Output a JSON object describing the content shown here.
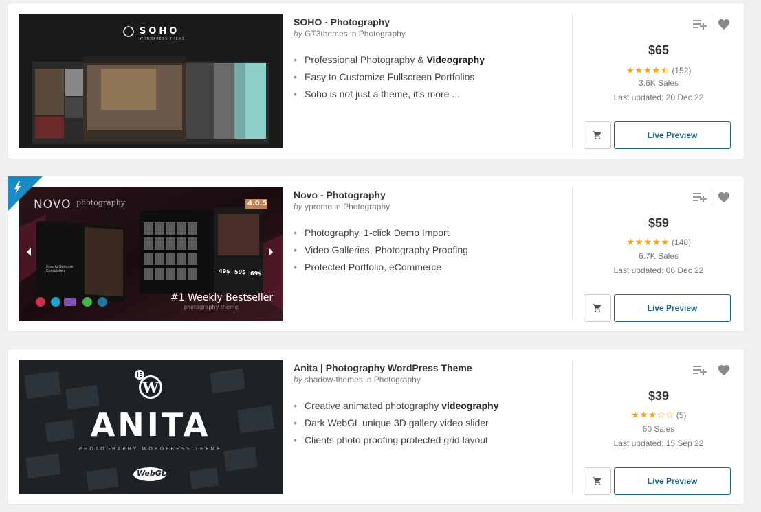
{
  "items": [
    {
      "title": "SOHO - Photography",
      "by": "by",
      "author": "GT3themes",
      "in": "in",
      "category": "Photography",
      "features": [
        {
          "text": "Professional Photography & ",
          "bold": "Videography"
        },
        {
          "text": "Easy to Customize Fullscreen Portfolios",
          "bold": ""
        },
        {
          "text": "Soho is not just a theme, it's more ...",
          "bold": ""
        }
      ],
      "price": "$65",
      "stars": "★★★★⯪",
      "rating_count": 4.5,
      "reviews": "(152)",
      "sales": "3.6K Sales",
      "updated": "Last updated: 20 Dec 22",
      "preview": "Live Preview",
      "thumb": {
        "brand": "SOHO",
        "sub": "WORDPRESS THEME"
      }
    },
    {
      "title": "Novo - Photography",
      "by": "by",
      "author": "ypromo",
      "in": "in",
      "category": "Photography",
      "features": [
        {
          "text": "Photography, 1-click Demo Import",
          "bold": ""
        },
        {
          "text": "Video Galleries, Photography Proofing",
          "bold": ""
        },
        {
          "text": "Protected Portfolio, eCommerce",
          "bold": ""
        }
      ],
      "price": "$59",
      "stars": "★★★★★",
      "rating_count": 5,
      "reviews": "(148)",
      "sales": "6.7K Sales",
      "updated": "Last updated: 06 Dec 22",
      "preview": "Live Preview",
      "thumb": {
        "brand": "NOVO",
        "brand2": "photography",
        "version": "4.0.5",
        "tag": "#1 Weekly Bestseller",
        "tag2": "photography theme",
        "line1": "How to Become",
        "line2": "Completely",
        "p1": "49$",
        "p2": "59$",
        "p3": "69$"
      }
    },
    {
      "title": "Anita | Photography WordPress Theme",
      "by": "by",
      "author": "shadow-themes",
      "in": "in",
      "category": "Photography",
      "features": [
        {
          "text": "Creative animated photography ",
          "bold": "videography"
        },
        {
          "text": "Dark WebGL unique 3D gallery video slider",
          "bold": ""
        },
        {
          "text": "Clients photo proofing protected grid layout",
          "bold": ""
        }
      ],
      "price": "$39",
      "stars": "★★★☆☆",
      "rating_count": 3,
      "reviews": "(5)",
      "sales": "60 Sales",
      "updated": "Last updated: 15 Sep 22",
      "preview": "Live Preview",
      "thumb": {
        "brand": "ANITA",
        "sub": "PHOTOGRAPHY WORDPRESS THEME",
        "badge": "WebGL"
      }
    }
  ],
  "colors": {
    "accent": "#1f6587",
    "star": "#f4a623",
    "featured": "#1a8bc4"
  }
}
